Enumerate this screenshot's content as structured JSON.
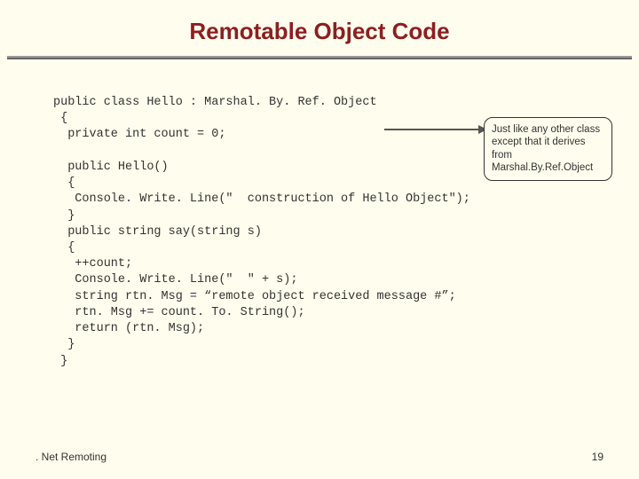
{
  "title": "Remotable Object Code",
  "code": "public class Hello : Marshal. By. Ref. Object\n {\n  private int count = 0;\n\n  public Hello()\n  {\n   Console. Write. Line(\"  construction of Hello Object\");\n  }\n  public string say(string s)\n  {\n   ++count;\n   Console. Write. Line(\"  \" + s);\n   string rtn. Msg = “remote object received message #”;\n   rtn. Msg += count. To. String();\n   return (rtn. Msg);\n  }\n }",
  "callout": "Just like any other class except that it derives from Marshal.By.Ref.Object",
  "footer": {
    "left": ". Net Remoting",
    "right": "19"
  }
}
